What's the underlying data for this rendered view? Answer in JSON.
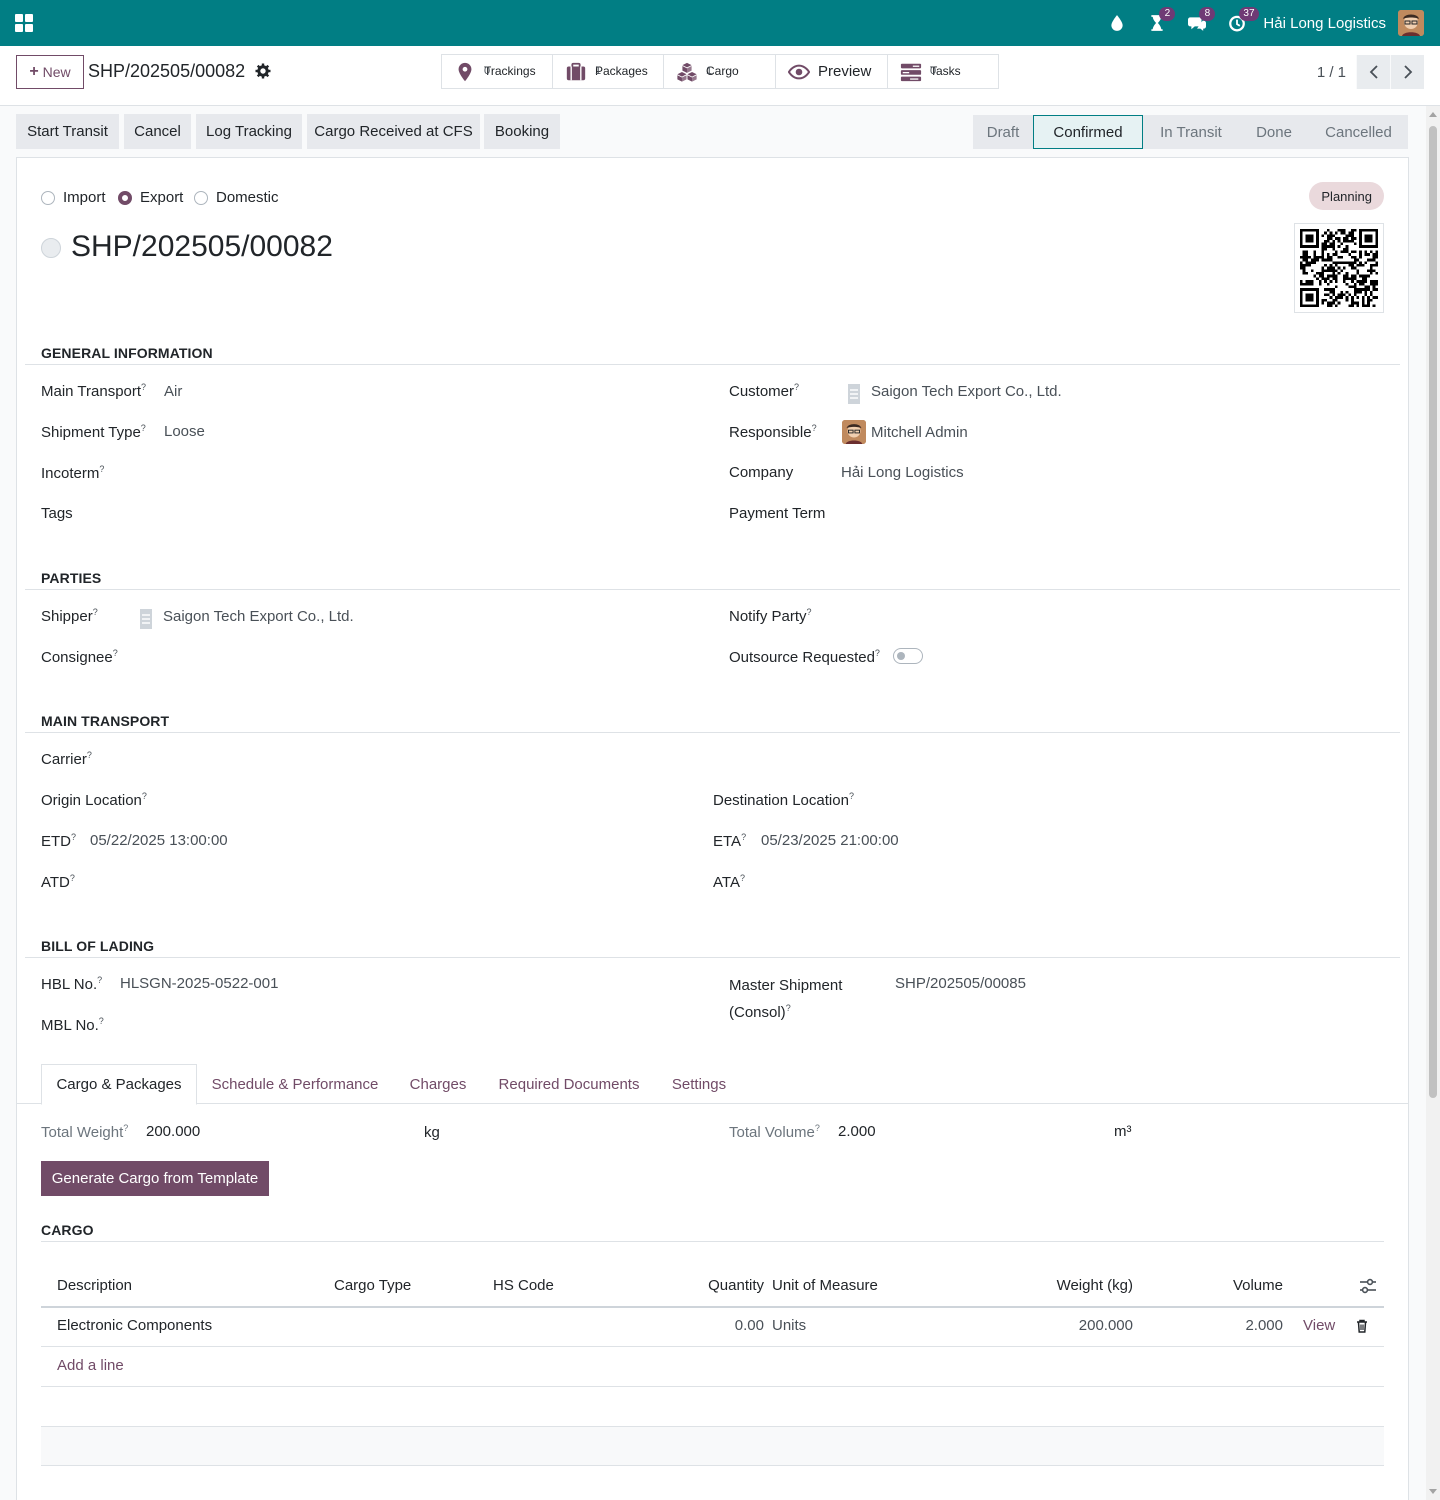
{
  "topbar": {
    "company": "Hải Long Logistics",
    "badges": {
      "activities": "2",
      "messages": "8",
      "clock": "37"
    },
    "colors": {
      "brand": "#017e84",
      "accent": "#714b67"
    },
    "icons": [
      "apps-icon",
      "water-drop-icon",
      "hourglass-icon",
      "chat-icon",
      "clock-icon"
    ]
  },
  "controlpanel": {
    "new_label": "New",
    "record_title": "SHP/202505/00082",
    "smart_buttons": [
      {
        "label": "Trackings",
        "value": "0",
        "icon": "map-pin-icon"
      },
      {
        "label": "Packages",
        "value": "1",
        "icon": "suitcase-icon"
      },
      {
        "label": "Cargo",
        "value": "1",
        "icon": "cubes-icon"
      },
      {
        "label": "Preview",
        "icon": "eye-icon"
      },
      {
        "label": "Tasks",
        "value": "0",
        "icon": "tasks-icon"
      }
    ],
    "pager": "1 / 1"
  },
  "statusbar": {
    "actions": [
      "Start Transit",
      "Cancel",
      "Log Tracking",
      "Cargo Received at CFS",
      "Booking"
    ],
    "stages": [
      "Draft",
      "Confirmed",
      "In Transit",
      "Done",
      "Cancelled"
    ],
    "active_stage": "Confirmed"
  },
  "sheet": {
    "direction": {
      "options": [
        "Import",
        "Export",
        "Domestic"
      ],
      "selected": "Export"
    },
    "planning_badge": "Planning",
    "title": "SHP/202505/00082",
    "general": {
      "section": "GENERAL INFORMATION",
      "main_transport_label": "Main Transport",
      "main_transport": "Air",
      "shipment_type_label": "Shipment Type",
      "shipment_type": "Loose",
      "incoterm_label": "Incoterm",
      "tags_label": "Tags",
      "customer_label": "Customer",
      "customer": "Saigon Tech Export Co., Ltd.",
      "responsible_label": "Responsible",
      "responsible": "Mitchell Admin",
      "company_label": "Company",
      "company": "Hải Long Logistics",
      "payment_term_label": "Payment Term"
    },
    "parties": {
      "section": "PARTIES",
      "shipper_label": "Shipper",
      "shipper": "Saigon Tech Export Co., Ltd.",
      "consignee_label": "Consignee",
      "notify_label": "Notify Party",
      "outsource_label": "Outsource Requested",
      "outsource": false
    },
    "transport": {
      "section": "MAIN TRANSPORT",
      "carrier_label": "Carrier",
      "origin_label": "Origin Location",
      "destination_label": "Destination Location",
      "etd_label": "ETD",
      "etd": "05/22/2025 13:00:00",
      "eta_label": "ETA",
      "eta": "05/23/2025 21:00:00",
      "atd_label": "ATD",
      "ata_label": "ATA"
    },
    "bol": {
      "section": "BILL OF LADING",
      "hbl_label": "HBL No.",
      "hbl": "HLSGN-2025-0522-001",
      "mbl_label": "MBL No.",
      "master_label_1": "Master Shipment",
      "master_label_2": "(Consol)",
      "master": "SHP/202505/00085"
    },
    "tabs": [
      "Cargo & Packages",
      "Schedule & Performance",
      "Charges",
      "Required Documents",
      "Settings"
    ],
    "active_tab": "Cargo & Packages",
    "totals": {
      "weight_label": "Total Weight",
      "weight": "200.000",
      "weight_unit": "kg",
      "volume_label": "Total Volume",
      "volume": "2.000",
      "volume_unit": "m³"
    },
    "generate_label": "Generate Cargo from Template",
    "cargo": {
      "section": "CARGO",
      "headers": [
        "Description",
        "Cargo Type",
        "HS Code",
        "Quantity",
        "Unit of Measure",
        "Weight (kg)",
        "Volume"
      ],
      "rows": [
        {
          "description": "Electronic Components",
          "cargo_type": "",
          "hs_code": "",
          "quantity": "0.00",
          "uom": "Units",
          "weight": "200.000",
          "volume": "2.000",
          "action": "View"
        }
      ],
      "add_line": "Add a line"
    }
  }
}
